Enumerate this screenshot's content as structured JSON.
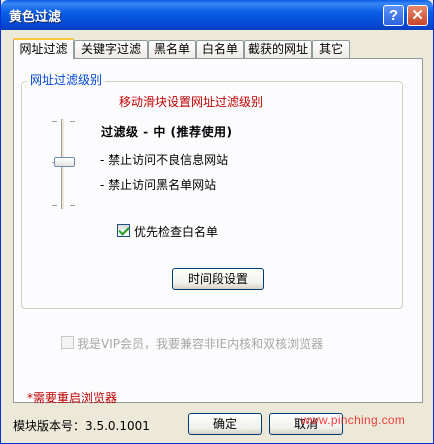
{
  "window": {
    "title": "黄色过滤",
    "help_label": "?",
    "close_label": "✕"
  },
  "tabs": [
    {
      "label": "网址过滤",
      "active": true
    },
    {
      "label": "关键字过滤",
      "active": false
    },
    {
      "label": "黑名单",
      "active": false
    },
    {
      "label": "白名单",
      "active": false
    },
    {
      "label": "截获的网址",
      "active": false
    },
    {
      "label": "其它",
      "active": false
    }
  ],
  "filter_group": {
    "legend": "网址过滤级别",
    "hint": "移动滑块设置网址过滤级别",
    "slider": {
      "positions": 3,
      "selected_index": 1
    },
    "level_title": "过滤级 - 中 (推荐使用)",
    "rules": [
      "- 禁止访问不良信息网站",
      "- 禁止访问黑名单网站"
    ],
    "whitelist_checkbox": {
      "label": "优先检查白名单",
      "checked": true
    },
    "schedule_button": "时间段设置"
  },
  "vip_checkbox": {
    "label": "我是VIP会员，我要兼容非IE内核和双核浏览器",
    "checked": false,
    "enabled": false
  },
  "restart_note": "*需要重启浏览器",
  "footer": {
    "version": "模块版本号：3.5.0.1001",
    "ok_label": "确定",
    "cancel_label": "取消",
    "watermark": "www.pinching.com"
  },
  "colors": {
    "title_bar": "#0A5FE8",
    "hint": "#C00000",
    "legend": "#0046D5"
  }
}
